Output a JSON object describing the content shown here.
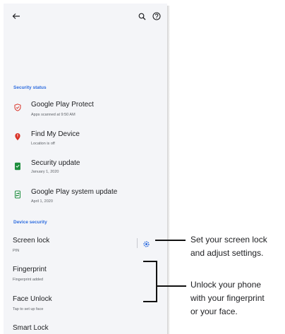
{
  "sections": {
    "security_status": "Security status",
    "device_security": "Device security"
  },
  "status_items": [
    {
      "title": "Google Play Protect",
      "subtitle": "Apps scanned at 9:50 AM",
      "icon": "shield-icon",
      "color": "#d93025"
    },
    {
      "title": "Find My Device",
      "subtitle": "Location is off",
      "icon": "location-pin-icon",
      "color": "#d93025"
    },
    {
      "title": "Security update",
      "subtitle": "January 1, 2020",
      "icon": "security-update-icon",
      "color": "#1e8e3e"
    },
    {
      "title": "Google Play system update",
      "subtitle": "April 1, 2020",
      "icon": "system-update-icon",
      "color": "#1e8e3e"
    }
  ],
  "device_items": [
    {
      "title": "Screen lock",
      "subtitle": "PIN"
    },
    {
      "title": "Fingerprint",
      "subtitle": "Fingerprint added"
    },
    {
      "title": "Face Unlock",
      "subtitle": "Tap to set up face"
    },
    {
      "title": "Smart Lock",
      "subtitle": ""
    }
  ],
  "callouts": {
    "screen_lock": [
      "Set your screen lock",
      "and adjust settings."
    ],
    "unlock": [
      "Unlock your phone",
      "with your fingerprint",
      "or your face."
    ]
  },
  "colors": {
    "accent": "#2d6cdf",
    "alert": "#d93025",
    "ok": "#1e8e3e"
  }
}
